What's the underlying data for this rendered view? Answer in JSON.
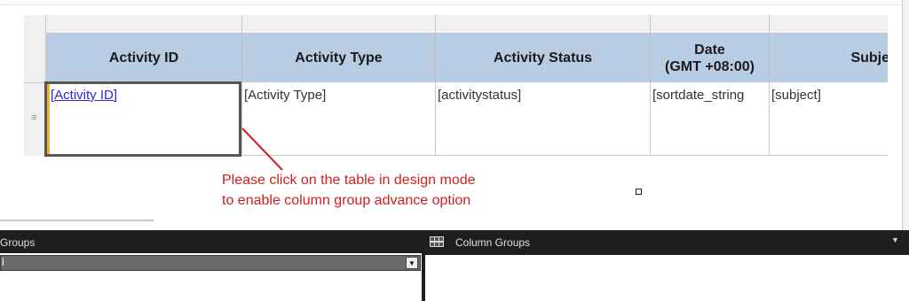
{
  "table": {
    "headers": [
      "Activity ID",
      "Activity Type",
      "Activity Status",
      "Date\n(GMT +08:00)",
      "Subje"
    ],
    "cells": [
      "[Activity ID]",
      "[Activity Type]",
      "[activitystatus]",
      "[sortdate_string",
      "[subject]"
    ]
  },
  "annotation": {
    "line1": "Please click on the table in design mode",
    "line2": "to enable column group advance option",
    "color": "#d02020"
  },
  "panels": {
    "row_groups_title": "Groups",
    "column_groups_title": "Column Groups",
    "row_group_item": "l"
  },
  "colors": {
    "header_bg": "#b8cce4",
    "link": "#2a2ad8",
    "panel_bg": "#2d2d30"
  }
}
